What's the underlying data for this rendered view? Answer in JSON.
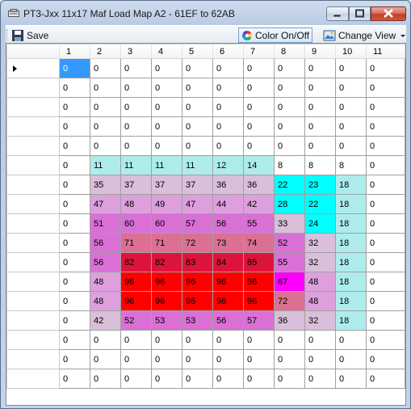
{
  "window": {
    "title": "PT3-Jxx 11x17 Maf Load Map A2 - 61EF to 62AB"
  },
  "toolbar": {
    "save_label": "Save",
    "color_label": "Color On/Off",
    "view_label": "Change View"
  },
  "icons": {
    "app": "app-icon",
    "save": "floppy-disk-icon",
    "color": "color-wheel-icon",
    "view": "view-icon",
    "dropdown": "chevron-down-icon"
  },
  "grid": {
    "columns": [
      "1",
      "2",
      "3",
      "4",
      "5",
      "6",
      "7",
      "8",
      "9",
      "10",
      "11"
    ],
    "selected": {
      "row": 0,
      "col": 0
    },
    "rows": [
      [
        0,
        0,
        0,
        0,
        0,
        0,
        0,
        0,
        0,
        0,
        0
      ],
      [
        0,
        0,
        0,
        0,
        0,
        0,
        0,
        0,
        0,
        0,
        0
      ],
      [
        0,
        0,
        0,
        0,
        0,
        0,
        0,
        0,
        0,
        0,
        0
      ],
      [
        0,
        0,
        0,
        0,
        0,
        0,
        0,
        0,
        0,
        0,
        0
      ],
      [
        0,
        0,
        0,
        0,
        0,
        0,
        0,
        0,
        0,
        0,
        0
      ],
      [
        0,
        11,
        11,
        11,
        11,
        12,
        14,
        8,
        8,
        8,
        0
      ],
      [
        0,
        35,
        37,
        37,
        37,
        36,
        36,
        22,
        23,
        18,
        0
      ],
      [
        0,
        47,
        48,
        49,
        47,
        44,
        42,
        28,
        22,
        18,
        0
      ],
      [
        0,
        51,
        60,
        60,
        57,
        56,
        55,
        33,
        24,
        18,
        0
      ],
      [
        0,
        56,
        71,
        71,
        72,
        73,
        74,
        52,
        32,
        18,
        0
      ],
      [
        0,
        56,
        82,
        82,
        83,
        84,
        85,
        55,
        32,
        18,
        0
      ],
      [
        0,
        48,
        96,
        96,
        96,
        96,
        96,
        67,
        48,
        18,
        0
      ],
      [
        0,
        48,
        96,
        96,
        96,
        96,
        96,
        72,
        48,
        18,
        0
      ],
      [
        0,
        42,
        52,
        53,
        53,
        56,
        57,
        36,
        32,
        18,
        0
      ],
      [
        0,
        0,
        0,
        0,
        0,
        0,
        0,
        0,
        0,
        0,
        0
      ],
      [
        0,
        0,
        0,
        0,
        0,
        0,
        0,
        0,
        0,
        0,
        0
      ],
      [
        0,
        0,
        0,
        0,
        0,
        0,
        0,
        0,
        0,
        0,
        0
      ]
    ],
    "colors": [
      [
        "#3399ff",
        "#ffffff",
        "#ffffff",
        "#ffffff",
        "#ffffff",
        "#ffffff",
        "#ffffff",
        "#ffffff",
        "#ffffff",
        "#ffffff",
        "#ffffff"
      ],
      [
        "#ffffff",
        "#ffffff",
        "#ffffff",
        "#ffffff",
        "#ffffff",
        "#ffffff",
        "#ffffff",
        "#ffffff",
        "#ffffff",
        "#ffffff",
        "#ffffff"
      ],
      [
        "#ffffff",
        "#ffffff",
        "#ffffff",
        "#ffffff",
        "#ffffff",
        "#ffffff",
        "#ffffff",
        "#ffffff",
        "#ffffff",
        "#ffffff",
        "#ffffff"
      ],
      [
        "#ffffff",
        "#ffffff",
        "#ffffff",
        "#ffffff",
        "#ffffff",
        "#ffffff",
        "#ffffff",
        "#ffffff",
        "#ffffff",
        "#ffffff",
        "#ffffff"
      ],
      [
        "#ffffff",
        "#ffffff",
        "#ffffff",
        "#ffffff",
        "#ffffff",
        "#ffffff",
        "#ffffff",
        "#ffffff",
        "#ffffff",
        "#ffffff",
        "#ffffff"
      ],
      [
        "#ffffff",
        "#aeecec",
        "#aeecec",
        "#aeecec",
        "#aeecec",
        "#aeecec",
        "#aeecec",
        "#ffffff",
        "#ffffff",
        "#ffffff",
        "#ffffff"
      ],
      [
        "#ffffff",
        "#d9bfd9",
        "#d9bfd9",
        "#d9bfd9",
        "#d9bfd9",
        "#d9bfd9",
        "#d9bfd9",
        "#00ffff",
        "#00ffff",
        "#aeecec",
        "#ffffff"
      ],
      [
        "#ffffff",
        "#dda0dd",
        "#dda0dd",
        "#dda0dd",
        "#dda0dd",
        "#dda0dd",
        "#dda0dd",
        "#00ffff",
        "#00ffff",
        "#aeecec",
        "#ffffff"
      ],
      [
        "#ffffff",
        "#da70d6",
        "#da70d6",
        "#da70d6",
        "#da70d6",
        "#da70d6",
        "#da70d6",
        "#d9bfd9",
        "#00ffff",
        "#aeecec",
        "#ffffff"
      ],
      [
        "#ffffff",
        "#da70d6",
        "#db7093",
        "#db7093",
        "#db7093",
        "#db7093",
        "#db7093",
        "#da70d6",
        "#d9bfd9",
        "#aeecec",
        "#ffffff"
      ],
      [
        "#ffffff",
        "#da70d6",
        "#dc143c",
        "#dc143c",
        "#dc143c",
        "#dc143c",
        "#dc143c",
        "#da70d6",
        "#d9bfd9",
        "#aeecec",
        "#ffffff"
      ],
      [
        "#ffffff",
        "#dda0dd",
        "#ff0000",
        "#ff0000",
        "#ff0000",
        "#ff0000",
        "#ff0000",
        "#ff00ff",
        "#dda0dd",
        "#aeecec",
        "#ffffff"
      ],
      [
        "#ffffff",
        "#dda0dd",
        "#ff0000",
        "#ff0000",
        "#ff0000",
        "#ff0000",
        "#ff0000",
        "#db7093",
        "#dda0dd",
        "#aeecec",
        "#ffffff"
      ],
      [
        "#ffffff",
        "#d9bfd9",
        "#da70d6",
        "#da70d6",
        "#da70d6",
        "#da70d6",
        "#da70d6",
        "#d9bfd9",
        "#d9bfd9",
        "#aeecec",
        "#ffffff"
      ],
      [
        "#ffffff",
        "#ffffff",
        "#ffffff",
        "#ffffff",
        "#ffffff",
        "#ffffff",
        "#ffffff",
        "#ffffff",
        "#ffffff",
        "#ffffff",
        "#ffffff"
      ],
      [
        "#ffffff",
        "#ffffff",
        "#ffffff",
        "#ffffff",
        "#ffffff",
        "#ffffff",
        "#ffffff",
        "#ffffff",
        "#ffffff",
        "#ffffff",
        "#ffffff"
      ],
      [
        "#ffffff",
        "#ffffff",
        "#ffffff",
        "#ffffff",
        "#ffffff",
        "#ffffff",
        "#ffffff",
        "#ffffff",
        "#ffffff",
        "#ffffff",
        "#ffffff"
      ]
    ]
  }
}
